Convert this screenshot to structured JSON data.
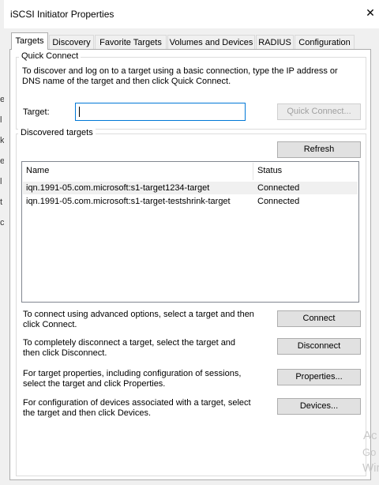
{
  "window": {
    "title": "iSCSI Initiator Properties",
    "close_glyph": "✕"
  },
  "background_fragments": [
    "e",
    "l",
    "k",
    "e",
    "l",
    "t",
    "c"
  ],
  "tabs": [
    {
      "label": "Targets",
      "active": true
    },
    {
      "label": "Discovery"
    },
    {
      "label": "Favorite Targets"
    },
    {
      "label": "Volumes and Devices"
    },
    {
      "label": "RADIUS"
    },
    {
      "label": "Configuration"
    }
  ],
  "quick_connect": {
    "legend": "Quick Connect",
    "description_line1": "To discover and log on to a target using a basic connection, type the IP address or",
    "description_line2": "DNS name of the target and then click Quick Connect.",
    "target_label": "Target:",
    "target_value": "",
    "button_label": "Quick Connect..."
  },
  "discovered": {
    "legend": "Discovered targets",
    "refresh_label": "Refresh",
    "columns": [
      "Name",
      "Status"
    ],
    "rows": [
      {
        "name": "iqn.1991-05.com.microsoft:s1-target1234-target",
        "status": "Connected"
      },
      {
        "name": "iqn.1991-05.com.microsoft:s1-target-testshrink-target",
        "status": "Connected"
      }
    ]
  },
  "actions": [
    {
      "line1": "To connect using advanced options, select a target and then",
      "line2": "click Connect.",
      "button": "Connect"
    },
    {
      "line1": "To completely disconnect a target, select the target and",
      "line2": "then click Disconnect.",
      "button": "Disconnect"
    },
    {
      "line1": "For target properties, including configuration of sessions,",
      "line2": "select the target and click Properties.",
      "button": "Properties..."
    },
    {
      "line1": "For configuration of devices associated with a target, select",
      "line2": "the target and then click Devices.",
      "button": "Devices..."
    }
  ],
  "watermark": [
    "Ac",
    "Go",
    "Wir"
  ]
}
